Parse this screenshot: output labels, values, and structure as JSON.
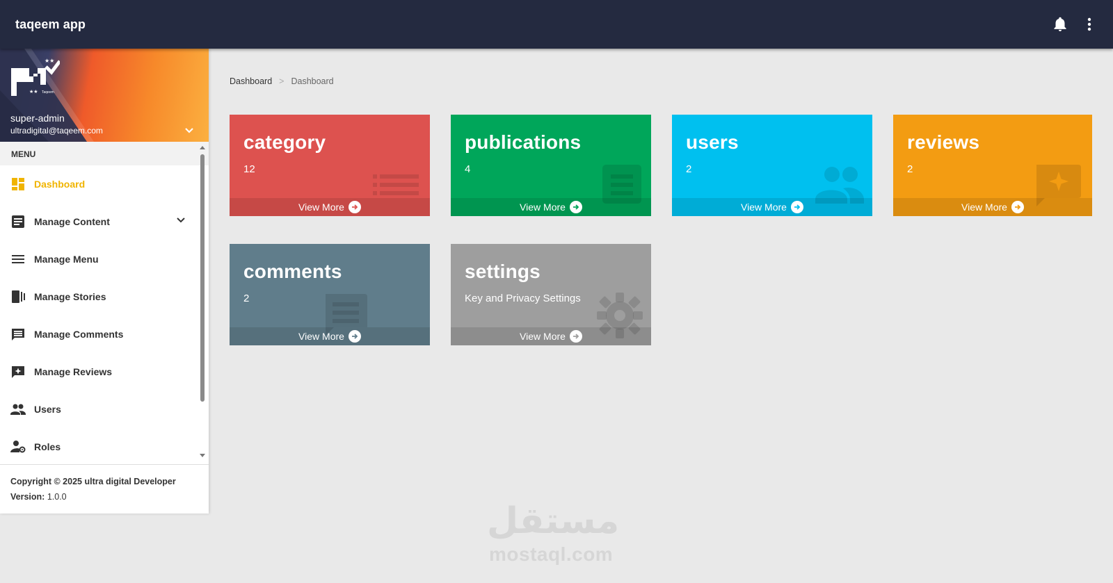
{
  "topbar": {
    "title": "taqeem app",
    "notification_icon": "bell-icon",
    "more_icon": "more-vertical-icon",
    "bg_color": "#242a40"
  },
  "profile": {
    "name": "super-admin",
    "email": "ultradigital@taqeem.com",
    "logo_icon": "taqeem-logo"
  },
  "menu": {
    "header": "MENU",
    "items": [
      {
        "label": "Dashboard",
        "icon": "dashboard-icon",
        "active": true
      },
      {
        "label": "Manage Content",
        "icon": "article-icon",
        "has_submenu": true
      },
      {
        "label": "Manage Menu",
        "icon": "menu-lines-icon"
      },
      {
        "label": "Manage Stories",
        "icon": "stories-icon"
      },
      {
        "label": "Manage Comments",
        "icon": "comment-icon"
      },
      {
        "label": "Manage Reviews",
        "icon": "review-icon"
      },
      {
        "label": "Users",
        "icon": "people-icon"
      },
      {
        "label": "Roles",
        "icon": "user-gear-icon"
      }
    ],
    "active_color": "#f0b400"
  },
  "footer": {
    "copyright": "Copyright © 2025 ultra digital Developer",
    "version_label": "Version:",
    "version_value": "1.0.0"
  },
  "breadcrumb": {
    "root": "Dashboard",
    "separator": ">",
    "current": "Dashboard"
  },
  "cards": [
    {
      "title": "category",
      "value": "12",
      "link": "View More",
      "color": "#dd524f",
      "icon": "list-icon"
    },
    {
      "title": "publications",
      "value": "4",
      "link": "View More",
      "color": "#00a65a",
      "icon": "document-icon"
    },
    {
      "title": "users",
      "value": "2",
      "link": "View More",
      "color": "#00c0ef",
      "icon": "people-icon"
    },
    {
      "title": "reviews",
      "value": "2",
      "link": "View More",
      "color": "#f39c12",
      "icon": "review-icon"
    },
    {
      "title": "comments",
      "value": "2",
      "link": "View More",
      "color": "#607d8b",
      "icon": "comment-icon"
    },
    {
      "title": "settings",
      "value": "Key and Privacy Settings",
      "link": "View More",
      "color": "#9e9e9e",
      "icon": "gear-icon"
    }
  ],
  "watermark": {
    "arabic": "مستقل",
    "latin": "mostaql.com"
  }
}
